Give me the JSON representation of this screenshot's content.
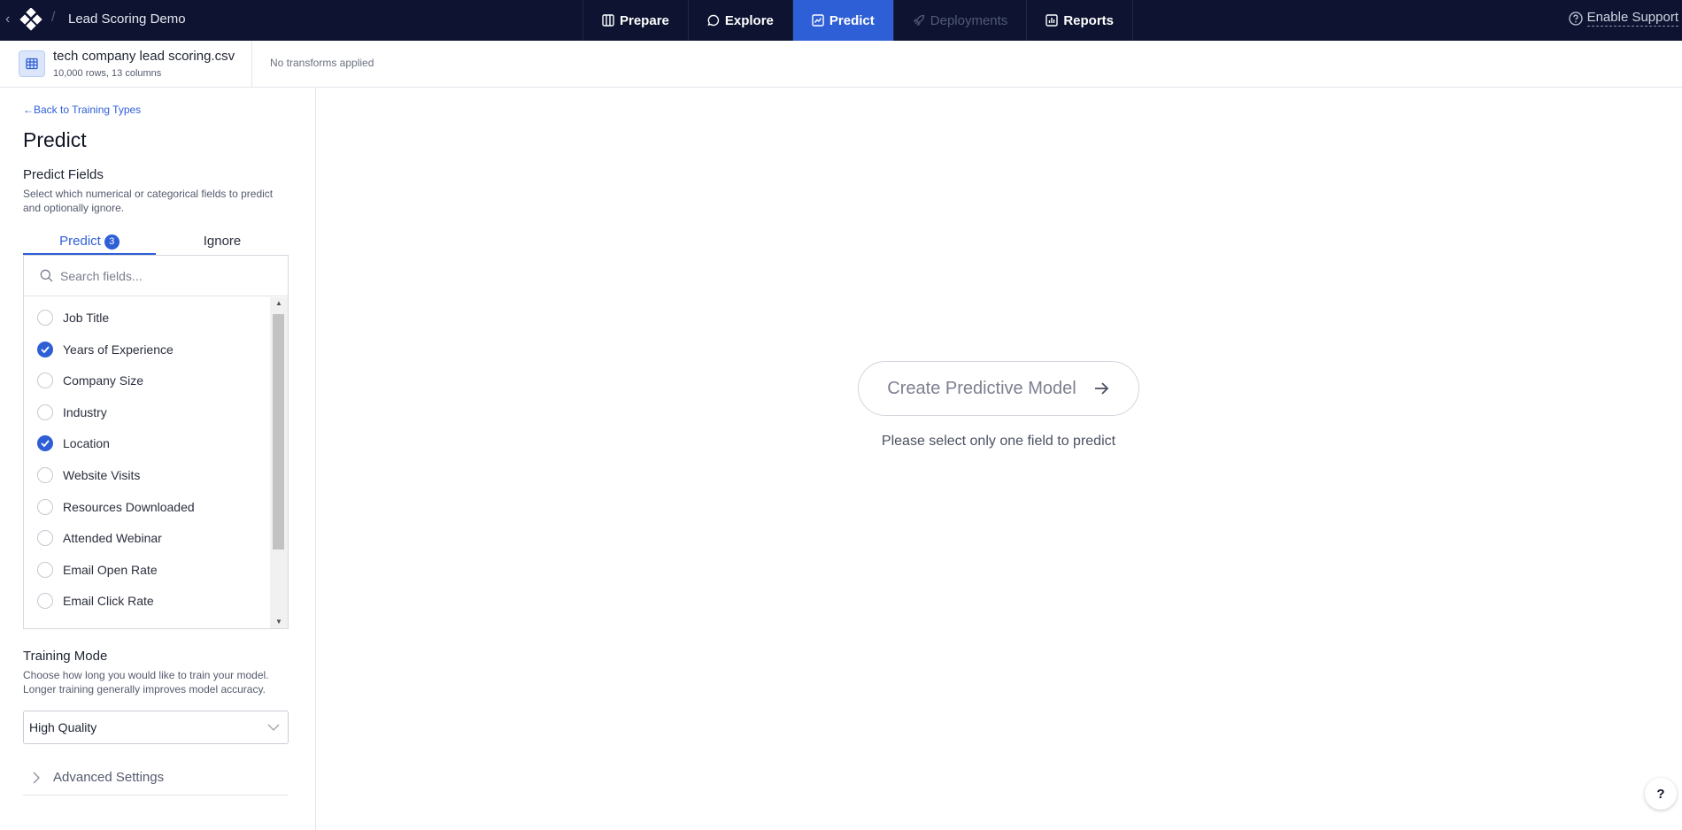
{
  "topbar": {
    "back_glyph": "‹",
    "logo_icon": "diamond-cluster-logo-icon",
    "separator": "/",
    "project_title": "Lead Scoring Demo",
    "tabs": [
      {
        "label": "Prepare",
        "icon": "table-columns-icon",
        "state": "normal"
      },
      {
        "label": "Explore",
        "icon": "chat-bubble-icon",
        "state": "normal"
      },
      {
        "label": "Predict",
        "icon": "chart-line-icon",
        "state": "active"
      },
      {
        "label": "Deployments",
        "icon": "rocket-icon",
        "state": "disabled"
      },
      {
        "label": "Reports",
        "icon": "bar-chart-icon",
        "state": "normal"
      }
    ],
    "support_label": "Enable Support",
    "support_icon": "question-circle-icon",
    "active_color": "#2f5fd6",
    "background_color": "#0d1330"
  },
  "dataset": {
    "name": "tech company lead scoring.csv",
    "meta": "10,000 rows, 13 columns",
    "transforms": "No transforms applied",
    "icon": "table-icon"
  },
  "sidebar": {
    "back_link": "Back to Training Types",
    "back_icon": "arrow-left-icon",
    "title": "Predict",
    "predict_fields": {
      "title": "Predict Fields",
      "description": "Select which numerical or categorical fields to predict and optionally ignore."
    },
    "field_tabs": {
      "predict_label": "Predict",
      "predict_count": "3",
      "ignore_label": "Ignore"
    },
    "search": {
      "placeholder": "Search fields...",
      "value": ""
    },
    "fields": [
      {
        "label": "Job Title",
        "checked": false
      },
      {
        "label": "Years of Experience",
        "checked": true
      },
      {
        "label": "Company Size",
        "checked": false
      },
      {
        "label": "Industry",
        "checked": false
      },
      {
        "label": "Location",
        "checked": true
      },
      {
        "label": "Website Visits",
        "checked": false
      },
      {
        "label": "Resources Downloaded",
        "checked": false
      },
      {
        "label": "Attended Webinar",
        "checked": false
      },
      {
        "label": "Email Open Rate",
        "checked": false
      },
      {
        "label": "Email Click Rate",
        "checked": false
      }
    ],
    "training_mode": {
      "title": "Training Mode",
      "description": "Choose how long you would like to train your model. Longer training generally improves model accuracy.",
      "selected": "High Quality"
    },
    "advanced_label": "Advanced Settings"
  },
  "main": {
    "create_button_label": "Create Predictive Model",
    "note": "Please select only one field to predict",
    "help_label": "?"
  }
}
